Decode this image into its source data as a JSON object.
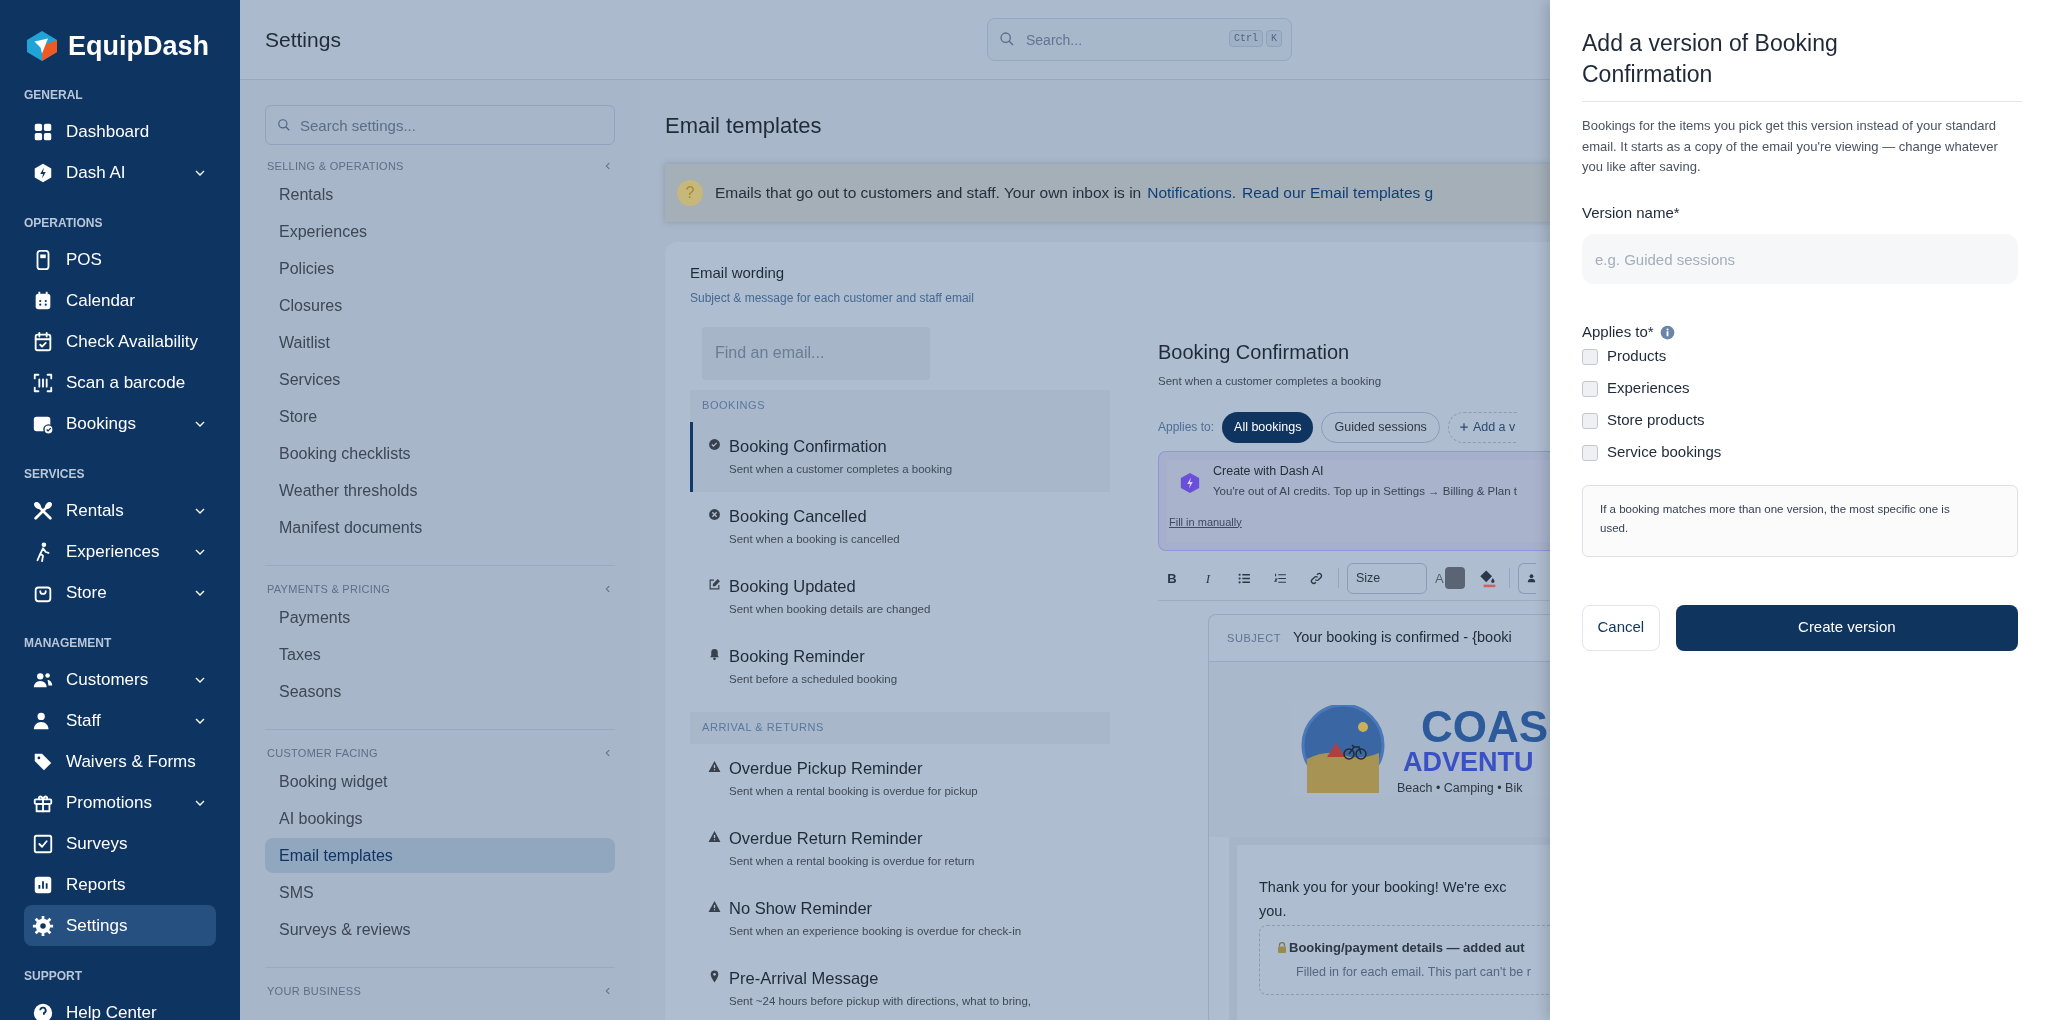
{
  "sidebar": {
    "brand": "EquipDash",
    "sections": [
      {
        "title": "GENERAL",
        "items": [
          {
            "label": "Dashboard",
            "expandable": false,
            "selected": false
          },
          {
            "label": "Dash AI",
            "expandable": true,
            "selected": false
          }
        ]
      },
      {
        "title": "OPERATIONS",
        "items": [
          {
            "label": "POS",
            "expandable": false,
            "selected": false
          },
          {
            "label": "Calendar",
            "expandable": false,
            "selected": false
          },
          {
            "label": "Check Availability",
            "expandable": false,
            "selected": false
          },
          {
            "label": "Scan a barcode",
            "expandable": false,
            "selected": false
          },
          {
            "label": "Bookings",
            "expandable": true,
            "selected": false
          }
        ]
      },
      {
        "title": "SERVICES",
        "items": [
          {
            "label": "Rentals",
            "expandable": true,
            "selected": false
          },
          {
            "label": "Experiences",
            "expandable": true,
            "selected": false
          },
          {
            "label": "Store",
            "expandable": true,
            "selected": false
          }
        ]
      },
      {
        "title": "MANAGEMENT",
        "items": [
          {
            "label": "Customers",
            "expandable": true,
            "selected": false
          },
          {
            "label": "Staff",
            "expandable": true,
            "selected": false
          },
          {
            "label": "Waivers & Forms",
            "expandable": false,
            "selected": false
          },
          {
            "label": "Promotions",
            "expandable": true,
            "selected": false
          },
          {
            "label": "Surveys",
            "expandable": false,
            "selected": false
          },
          {
            "label": "Reports",
            "expandable": false,
            "selected": false
          },
          {
            "label": "Settings",
            "expandable": false,
            "selected": true
          }
        ]
      },
      {
        "title": "SUPPORT",
        "items": [
          {
            "label": "Help Center",
            "expandable": false,
            "selected": false
          }
        ]
      }
    ]
  },
  "topbar": {
    "title": "Settings",
    "search": {
      "placeholder": "Search...",
      "keys": [
        "Ctrl",
        "K"
      ]
    }
  },
  "settings_nav": {
    "search": {
      "placeholder": "Search settings..."
    },
    "groups": [
      {
        "title": "SELLING & OPERATIONS",
        "items": [
          {
            "label": "Rentals",
            "selected": false
          },
          {
            "label": "Experiences",
            "selected": false
          },
          {
            "label": "Policies",
            "selected": false
          },
          {
            "label": "Closures",
            "selected": false
          },
          {
            "label": "Waitlist",
            "selected": false
          },
          {
            "label": "Services",
            "selected": false
          },
          {
            "label": "Store",
            "selected": false
          },
          {
            "label": "Booking checklists",
            "selected": false
          },
          {
            "label": "Weather thresholds",
            "selected": false
          },
          {
            "label": "Manifest documents",
            "selected": false
          }
        ]
      },
      {
        "title": "PAYMENTS & PRICING",
        "items": [
          {
            "label": "Payments",
            "selected": false
          },
          {
            "label": "Taxes",
            "selected": false
          },
          {
            "label": "Seasons",
            "selected": false
          }
        ]
      },
      {
        "title": "CUSTOMER FACING",
        "items": [
          {
            "label": "Booking widget",
            "selected": false
          },
          {
            "label": "AI bookings",
            "selected": false
          },
          {
            "label": "Email templates",
            "selected": true
          },
          {
            "label": "SMS",
            "selected": false
          },
          {
            "label": "Surveys & reviews",
            "selected": false
          }
        ]
      },
      {
        "title": "YOUR BUSINESS"
      }
    ]
  },
  "page": {
    "title": "Email templates",
    "banner": {
      "glyph": "?",
      "text": "Emails that go out to customers and staff. Your own inbox is in",
      "links": [
        "Notifications.",
        "Read our Email templates g"
      ]
    }
  },
  "email_wording": {
    "title": "Email wording",
    "subtitle": "Subject & message for each customer and staff email",
    "search": {
      "placeholder": "Find an email..."
    },
    "groups": [
      {
        "title": "BOOKINGS",
        "items": [
          {
            "title": "Booking Confirmation",
            "description": "Sent when a customer completes a booking",
            "selected": true
          },
          {
            "title": "Booking Cancelled",
            "description": "Sent when a booking is cancelled",
            "selected": false
          },
          {
            "title": "Booking Updated",
            "description": "Sent when booking details are changed",
            "selected": false
          },
          {
            "title": "Booking Reminder",
            "description": "Sent before a scheduled booking",
            "selected": false
          }
        ]
      },
      {
        "title": "ARRIVAL & RETURNS",
        "items": [
          {
            "title": "Overdue Pickup Reminder",
            "description": "Sent when a rental booking is overdue for pickup",
            "selected": false
          },
          {
            "title": "Overdue Return Reminder",
            "description": "Sent when a rental booking is overdue for return",
            "selected": false
          },
          {
            "title": "No Show Reminder",
            "description": "Sent when an experience booking is overdue for check-in",
            "selected": false
          },
          {
            "title": "Pre-Arrival Message",
            "description": "Sent ~24 hours before pickup with directions, what to bring,",
            "selected": false
          }
        ]
      }
    ]
  },
  "editor": {
    "title": "Booking Confirmation",
    "subtitle": "Sent when a customer completes a booking",
    "applies_label": "Applies to:",
    "versions": [
      {
        "kind": "version",
        "label": "All bookings",
        "selected": true
      },
      {
        "kind": "version",
        "label": "Guided sessions",
        "selected": false
      },
      {
        "kind": "add",
        "label": "Add a v"
      }
    ],
    "ai": {
      "title": "Create with Dash AI",
      "message": "You're out of AI credits. Top up in Settings → Billing & Plan t",
      "link": "Fill in manually"
    },
    "toolbar": {
      "bold": "B",
      "italic": "I",
      "size": "Size",
      "text_color": "A"
    },
    "subject": {
      "label": "SUBJECT",
      "value": "Your booking is confirmed - {booki"
    },
    "logo": {
      "name": "COAS",
      "subname": "ADVENTU",
      "tagline": "Beach • Camping • Bik"
    },
    "body": [
      "Thank you for your booking! We're exc",
      "you."
    ],
    "details": {
      "title": "Booking/payment details — added aut",
      "note": "Filled in for each email. This part can't be r"
    }
  },
  "drawer": {
    "title": "Add a version of Booking Confirmation",
    "description": "Bookings for the items you pick get this version instead of your standard email. It starts as a copy of the email you're viewing — change whatever you like after saving.",
    "name_field": {
      "label": "Version name*",
      "placeholder": "e.g. Guided sessions"
    },
    "applies_label": "Applies to*",
    "options": [
      {
        "label": "Products",
        "checked": false
      },
      {
        "label": "Experiences",
        "checked": false
      },
      {
        "label": "Store products",
        "checked": false
      },
      {
        "label": "Service bookings",
        "checked": false
      }
    ],
    "note": "If a booking matches more than one version, the most specific one is used.",
    "cancel": "Cancel",
    "create": "Create version"
  }
}
